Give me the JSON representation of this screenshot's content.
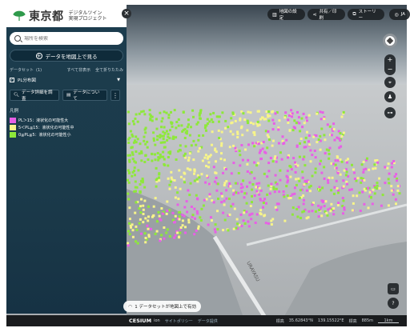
{
  "brand": {
    "org": "東京都",
    "project_line1": "デジタルツイン",
    "project_line2": "実現プロジェクト"
  },
  "close_label": "×",
  "search": {
    "placeholder": "場所を検索"
  },
  "add_data": {
    "label": "データを地図上で見る"
  },
  "dataset": {
    "title": "データセット",
    "count": "(1)",
    "action_1": "すべて非表示",
    "action_2": "全て折りたたみ"
  },
  "layer": {
    "name": "PL分布図",
    "checked": "✓"
  },
  "tools": {
    "details_label": "データ詳細を調査",
    "about_label": "データについて",
    "more_label": "⋮"
  },
  "legend": {
    "title": "凡例",
    "items": [
      {
        "label": "PL＞15：液状化の可能性大",
        "color": "#e85fe6"
      },
      {
        "label": "5＜PL≦15：液状化の可能性中",
        "color": "#f7f48a"
      },
      {
        "label": "0≦PL≦5：液状化の可能性小",
        "color": "#8ee83a"
      }
    ]
  },
  "topbar": {
    "map_settings": "地図の設定",
    "share": "共有／印刷",
    "story": "ストーリー",
    "lang": "JA"
  },
  "controls": {
    "zoom_in": "+",
    "zoom_out": "−"
  },
  "status": {
    "message": "1 データセットが地図上で有効"
  },
  "footer": {
    "cesium": "CESIUM",
    "ion": "ion",
    "privacy": "サイトポリシー",
    "data_attribution": "データ提供",
    "elevation_label": "標高",
    "lat": "35.62843°N",
    "lon": "139.15522°E",
    "height_label": "標高",
    "height": "885m",
    "scale": "1km"
  },
  "map": {
    "road_label": "URAYASU",
    "colors": {
      "high": "#e85fe6",
      "mid": "#f7f48a",
      "low": "#8ee83a",
      "sky_top": "#4a5660",
      "sky_bottom": "#d3d6d8",
      "ground": "#b8bcbf",
      "water": "#5b5e61"
    }
  }
}
